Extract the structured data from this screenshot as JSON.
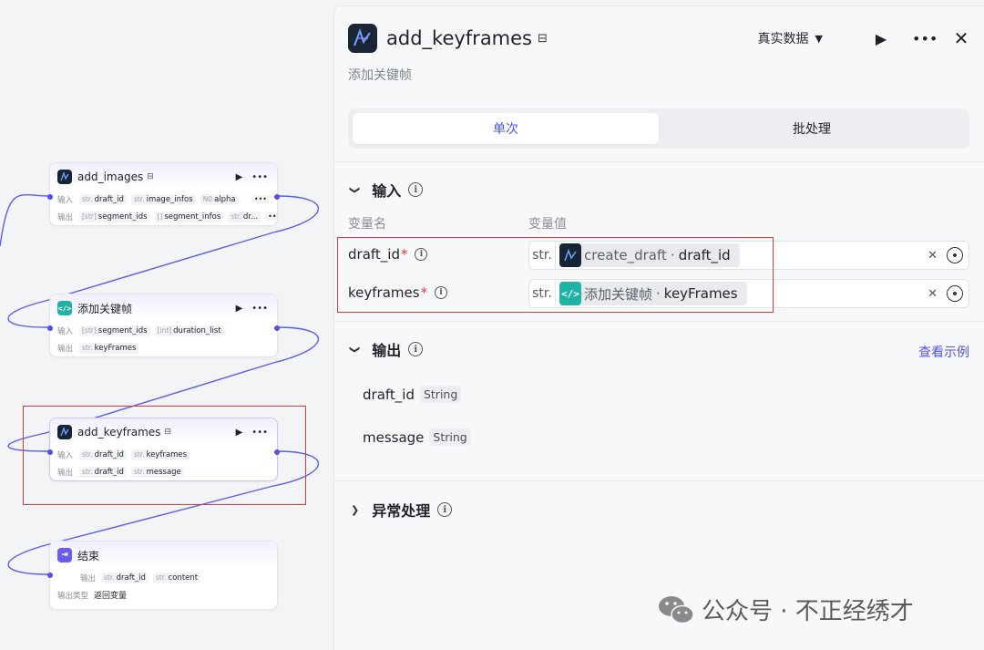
{
  "canvas": {
    "nodes": [
      {
        "id": "add_images",
        "title": "add_images",
        "icon": "app-logo-icon",
        "rows": [
          {
            "label": "输入",
            "tags": [
              {
                "type": "str.",
                "name": "draft_id"
              },
              {
                "type": "str.",
                "name": "image_infos"
              },
              {
                "type": "N0",
                "name": "alpha"
              }
            ]
          },
          {
            "label": "输出",
            "tags": [
              {
                "type": "[str]",
                "name": "segment_ids"
              },
              {
                "type": "[]",
                "name": "segment_infos"
              },
              {
                "type": "str.",
                "name": "dr..."
              }
            ]
          }
        ]
      },
      {
        "id": "add_keyframes_code",
        "title": "添加关键帧",
        "icon": "code-icon",
        "rows": [
          {
            "label": "输入",
            "tags": [
              {
                "type": "[str]",
                "name": "segment_ids"
              },
              {
                "type": "[int]",
                "name": "duration_list"
              }
            ]
          },
          {
            "label": "输出",
            "tags": [
              {
                "type": "str.",
                "name": "keyFrames"
              }
            ]
          }
        ]
      },
      {
        "id": "add_keyframes",
        "title": "add_keyframes",
        "icon": "app-logo-icon",
        "rows": [
          {
            "label": "输入",
            "tags": [
              {
                "type": "str.",
                "name": "draft_id"
              },
              {
                "type": "str.",
                "name": "keyframes"
              }
            ]
          },
          {
            "label": "输出",
            "tags": [
              {
                "type": "str.",
                "name": "draft_id"
              },
              {
                "type": "str.",
                "name": "message"
              }
            ]
          }
        ]
      },
      {
        "id": "end",
        "title": "结束",
        "icon": "end-icon",
        "rows": [
          {
            "label": "输出",
            "tags": [
              {
                "type": "str.",
                "name": "draft_id"
              },
              {
                "type": "str.",
                "name": "content"
              }
            ]
          },
          {
            "label": "输出类型",
            "value": "返回变量"
          }
        ]
      }
    ]
  },
  "panel": {
    "title": "add_keyframes",
    "description": "添加关键帧",
    "mode_select": "真实数据",
    "tabs": [
      "单次",
      "批处理"
    ],
    "input_section": {
      "title": "输入",
      "col_name": "变量名",
      "col_value": "变量值",
      "rows": [
        {
          "name": "draft_id",
          "required": "*",
          "type": "str.",
          "ref_node": "create_draft",
          "ref_var": "draft_id",
          "ref_icon": "app-logo-icon"
        },
        {
          "name": "keyframes",
          "required": "*",
          "type": "str.",
          "ref_node": "添加关键帧",
          "ref_var": "keyFrames",
          "ref_icon": "code-icon"
        }
      ]
    },
    "output_section": {
      "title": "输出",
      "link": "查看示例",
      "rows": [
        {
          "name": "draft_id",
          "type": "String"
        },
        {
          "name": "message",
          "type": "String"
        }
      ]
    },
    "error_section": {
      "title": "异常处理"
    }
  },
  "watermark": {
    "text": "公众号 · 不正经绣才"
  },
  "colors": {
    "accent": "#4d53e8",
    "highlight": "#e0383b",
    "edge": "#5a5ef0"
  }
}
